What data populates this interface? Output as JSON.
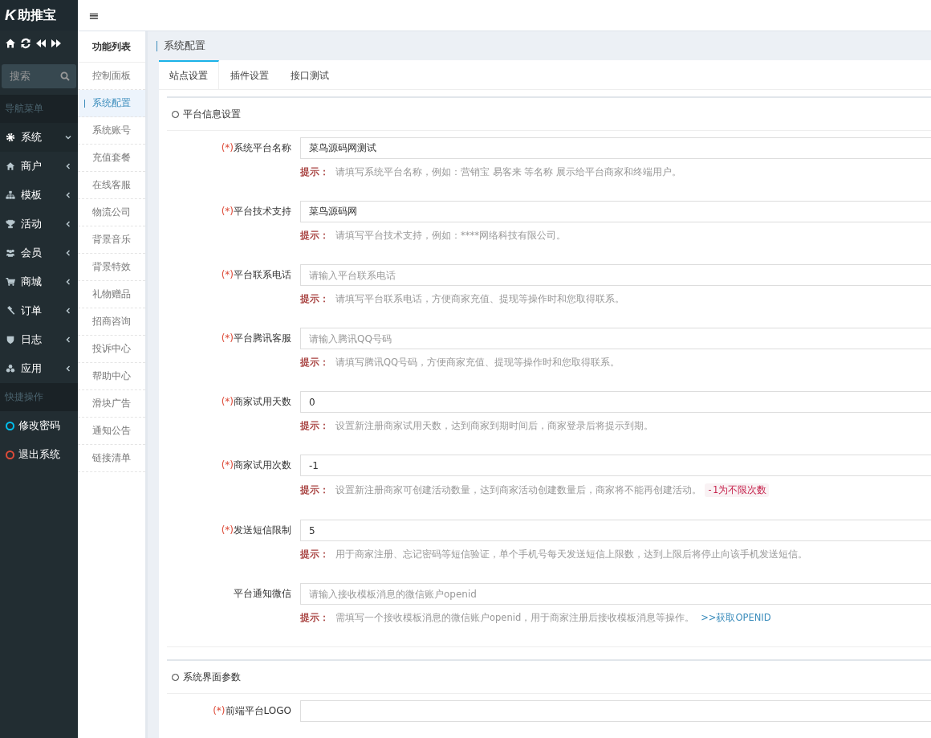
{
  "brand": {
    "mark": "K",
    "name": "助推宝"
  },
  "search": {
    "placeholder": "搜索"
  },
  "nav_header": "导航菜单",
  "nav": [
    {
      "label": "系统",
      "expanded": true,
      "selected": true
    },
    {
      "label": "商户",
      "expanded": false,
      "selected": false
    },
    {
      "label": "模板",
      "expanded": false,
      "selected": false
    },
    {
      "label": "活动",
      "expanded": false,
      "selected": false
    },
    {
      "label": "会员",
      "expanded": false,
      "selected": false
    },
    {
      "label": "商城",
      "expanded": false,
      "selected": false
    },
    {
      "label": "订单",
      "expanded": false,
      "selected": false
    },
    {
      "label": "日志",
      "expanded": false,
      "selected": false
    },
    {
      "label": "应用",
      "expanded": false,
      "selected": false
    }
  ],
  "quick_header": "快捷操作",
  "quick": [
    {
      "label": "修改密码",
      "color": "#00c0ef"
    },
    {
      "label": "退出系统",
      "color": "#dd4b39"
    }
  ],
  "menu_toggle": "≡",
  "function_list": {
    "title": "功能列表",
    "items": [
      {
        "label": "控制面板",
        "selected": false
      },
      {
        "label": "系统配置",
        "selected": true
      },
      {
        "label": "系统账号",
        "selected": false
      },
      {
        "label": "充值套餐",
        "selected": false
      },
      {
        "label": "在线客服",
        "selected": false
      },
      {
        "label": "物流公司",
        "selected": false
      },
      {
        "label": "背景音乐",
        "selected": false
      },
      {
        "label": "背景特效",
        "selected": false
      },
      {
        "label": "礼物赠品",
        "selected": false
      },
      {
        "label": "招商咨询",
        "selected": false
      },
      {
        "label": "投诉中心",
        "selected": false
      },
      {
        "label": "帮助中心",
        "selected": false
      },
      {
        "label": "滑块广告",
        "selected": false
      },
      {
        "label": "通知公告",
        "selected": false
      },
      {
        "label": "链接清单",
        "selected": false
      }
    ]
  },
  "page_title": "系统配置",
  "tabs": [
    {
      "label": "站点设置",
      "selected": true
    },
    {
      "label": "插件设置",
      "selected": false
    },
    {
      "label": "接口测试",
      "selected": false
    }
  ],
  "sections": [
    {
      "title": "平台信息设置",
      "fields": [
        {
          "required_mark": "(*)",
          "label": "系统平台名称",
          "value": "菜鸟源码网测试",
          "hint_label": "提示：",
          "hint": "请填写系统平台名称，例如：营销宝 易客来 等名称 展示给平台商家和终端用户。"
        },
        {
          "required_mark": "(*)",
          "label": "平台技术支持",
          "value": "菜鸟源码网",
          "hint_label": "提示：",
          "hint": "请填写平台技术支持，例如：****网络科技有限公司。"
        },
        {
          "required_mark": "(*)",
          "label": "平台联系电话",
          "placeholder": "请输入平台联系电话",
          "hint_label": "提示：",
          "hint": "请填写平台联系电话，方便商家充值、提现等操作时和您取得联系。"
        },
        {
          "required_mark": "(*)",
          "label": "平台腾讯客服",
          "placeholder": "请输入腾讯QQ号码",
          "hint_label": "提示：",
          "hint": "请填写腾讯QQ号码，方便商家充值、提现等操作时和您取得联系。"
        },
        {
          "required_mark": "(*)",
          "label": "商家试用天数",
          "value": "0",
          "hint_label": "提示：",
          "hint": "设置新注册商家试用天数，达到商家到期时间后，商家登录后将提示到期。"
        },
        {
          "required_mark": "(*)",
          "label": "商家试用次数",
          "value": "-1",
          "hint_label": "提示：",
          "hint": "设置新注册商家可创建活动数量，达到商家活动创建数量后，商家将不能再创建活动。",
          "code": "-1为不限次数"
        },
        {
          "required_mark": "(*)",
          "label": "发送短信限制",
          "value": "5",
          "hint_label": "提示：",
          "hint": "用于商家注册、忘记密码等短信验证，单个手机号每天发送短信上限数，达到上限后将停止向该手机发送短信。"
        },
        {
          "label": "平台通知微信",
          "placeholder": "请输入接收模板消息的微信账户openid",
          "hint_label": "提示：",
          "hint": "需填写一个接收模板消息的微信账户openid，用于商家注册后接收模板消息等操作。",
          "link": ">>获取OPENID"
        }
      ]
    },
    {
      "title": "系统界面参数",
      "fields": [
        {
          "required_mark": "(*)",
          "label": "前端平台LOGO"
        }
      ]
    }
  ]
}
